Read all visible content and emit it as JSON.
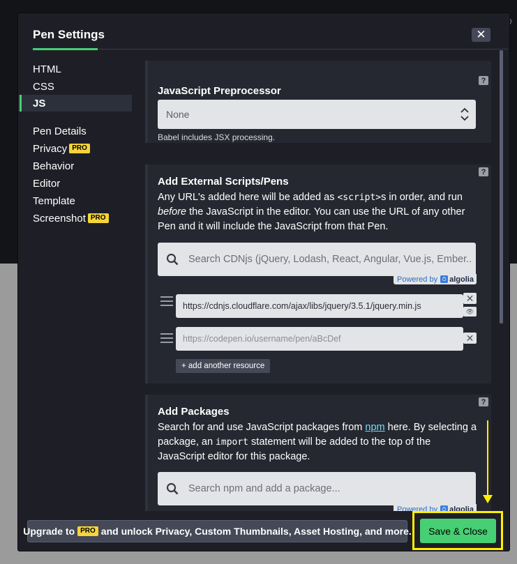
{
  "modal": {
    "title": "Pen Settings",
    "close_label": "✕"
  },
  "sidebar": {
    "items": [
      {
        "label": "HTML"
      },
      {
        "label": "CSS"
      },
      {
        "label": "JS"
      },
      {
        "label": "Pen Details"
      },
      {
        "label": "Privacy",
        "badge": "PRO"
      },
      {
        "label": "Behavior"
      },
      {
        "label": "Editor"
      },
      {
        "label": "Template"
      },
      {
        "label": "Screenshot",
        "badge": "PRO"
      }
    ],
    "active": "JS"
  },
  "js_preprocessor": {
    "title": "JavaScript Preprocessor",
    "selected": "None",
    "hint": "Babel includes JSX processing.",
    "help": "?"
  },
  "external_scripts": {
    "title": "Add External Scripts/Pens",
    "desc_1": "Any URL's added here will be added as ",
    "desc_code": "<script>",
    "desc_2": "s in order, and run ",
    "desc_em": "before",
    "desc_3": " the JavaScript in the editor. You can use the URL of any other Pen and it will include the JavaScript from that Pen.",
    "search_placeholder": "Search CDNjs (jQuery, Lodash, React, Angular, Vue.js, Ember..",
    "powered_by": "Powered by",
    "algolia": "algolia",
    "resources": [
      {
        "value": "https://cdnjs.cloudflare.com/ajax/libs/jquery/3.5.1/jquery.min.js"
      },
      {
        "value": "https://codepen.io/username/pen/aBcDef"
      }
    ],
    "add_label": "+ add another resource",
    "help": "?"
  },
  "packages": {
    "title": "Add Packages",
    "desc_1": "Search for and use JavaScript packages from ",
    "desc_link": "npm",
    "desc_2": " here. By selecting a package, an ",
    "desc_code": "import",
    "desc_3": " statement will be added to the top of the JavaScript editor for this package.",
    "search_placeholder": "Search npm and add a package...",
    "powered_by": "Powered by",
    "algolia": "algolia",
    "help": "?"
  },
  "footer": {
    "upgrade_prefix": "Upgrade to",
    "upgrade_badge": "PRO",
    "upgrade_suffix": "and unlock Privacy, Custom Thumbnails, Asset Hosting, and more.",
    "save_label": "Save & Close"
  },
  "colors": {
    "accent": "#47cf73",
    "pro_badge": "#f5d539",
    "annotation": "#ffef00",
    "panel_bg": "#252830"
  }
}
